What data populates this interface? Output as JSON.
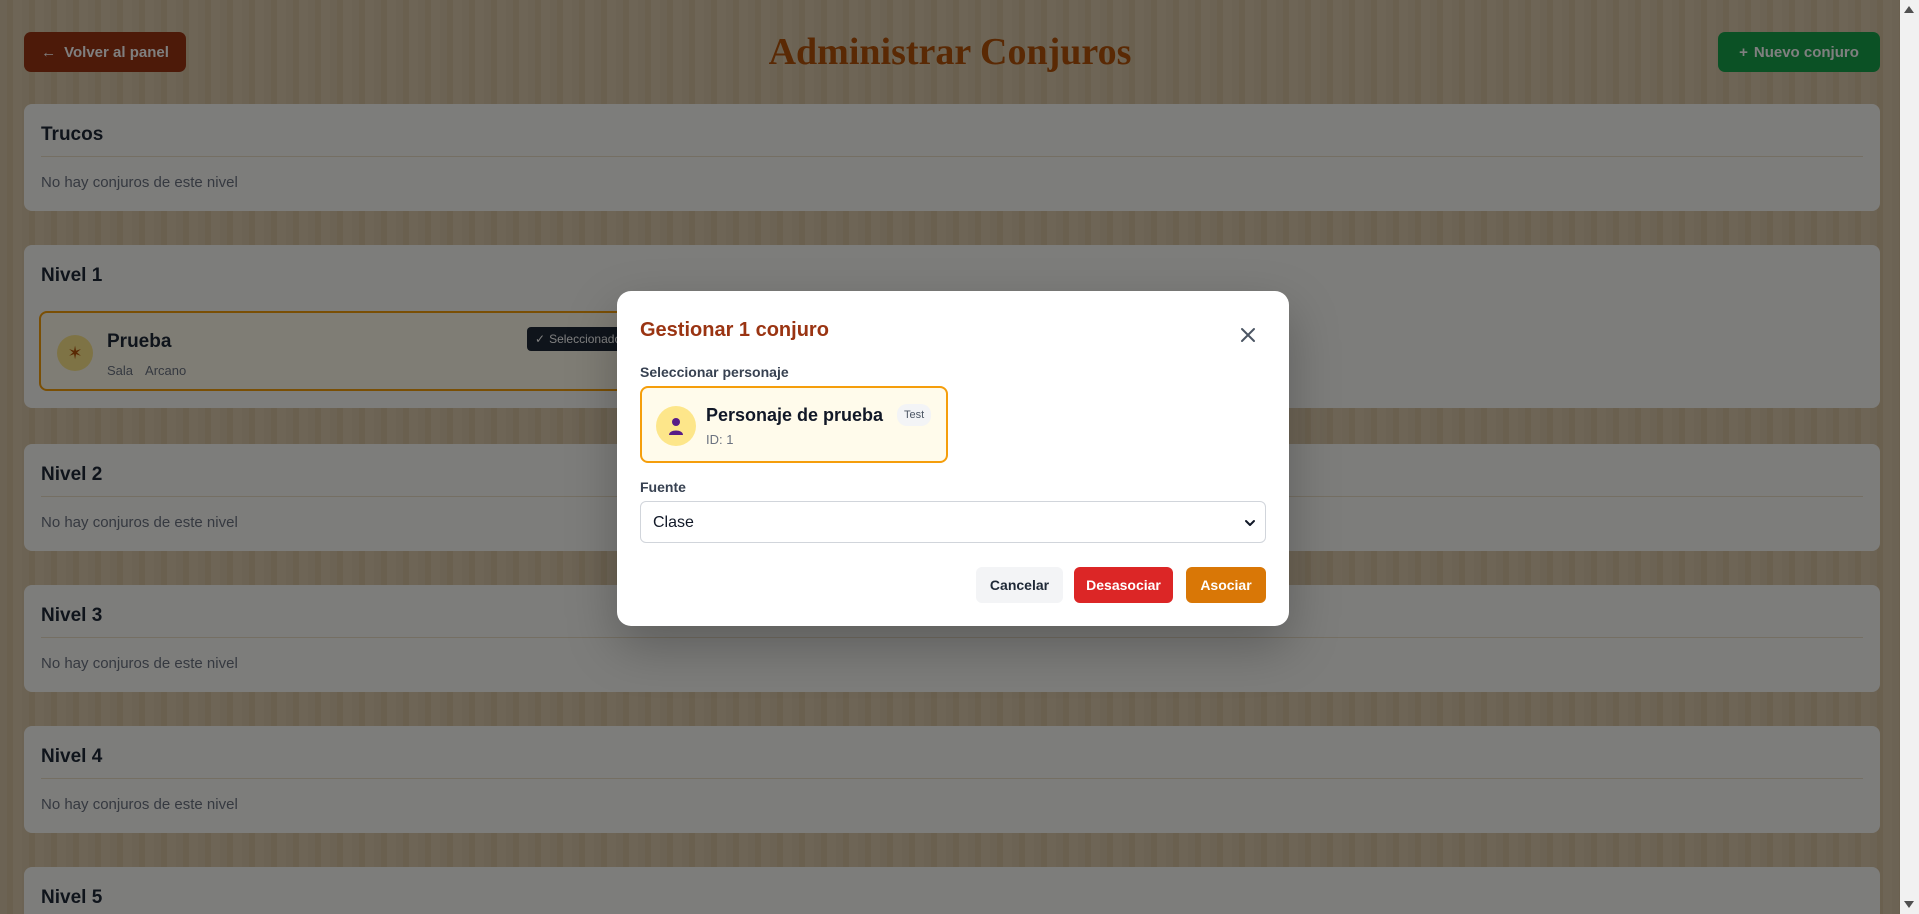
{
  "header": {
    "back_label": "Volver al panel",
    "title": "Administrar Conjuros",
    "new_label": "Nuevo conjuro"
  },
  "sections": [
    {
      "title": "Trucos",
      "empty": "No hay conjuros de este nivel"
    },
    {
      "title": "Nivel 1",
      "spell": {
        "name": "Prueba",
        "tags": [
          "Sala",
          "Arcano"
        ],
        "badge": "Seleccionado"
      }
    },
    {
      "title": "Nivel 2",
      "empty": "No hay conjuros de este nivel"
    },
    {
      "title": "Nivel 3",
      "empty": "No hay conjuros de este nivel"
    },
    {
      "title": "Nivel 4",
      "empty": "No hay conjuros de este nivel"
    },
    {
      "title": "Nivel 5"
    }
  ],
  "modal": {
    "title": "Gestionar 1 conjuro",
    "select_character_label": "Seleccionar personaje",
    "character": {
      "name": "Personaje de prueba",
      "id": "ID: 1",
      "tag": "Test"
    },
    "source_label": "Fuente",
    "source_value": "Clase",
    "buttons": {
      "cancel": "Cancelar",
      "unlink": "Desasociar",
      "link": "Asociar"
    }
  },
  "colors": {
    "accent": "#d97706",
    "danger": "#dc2626",
    "title": "#9a3412",
    "success": "#16a34a"
  }
}
